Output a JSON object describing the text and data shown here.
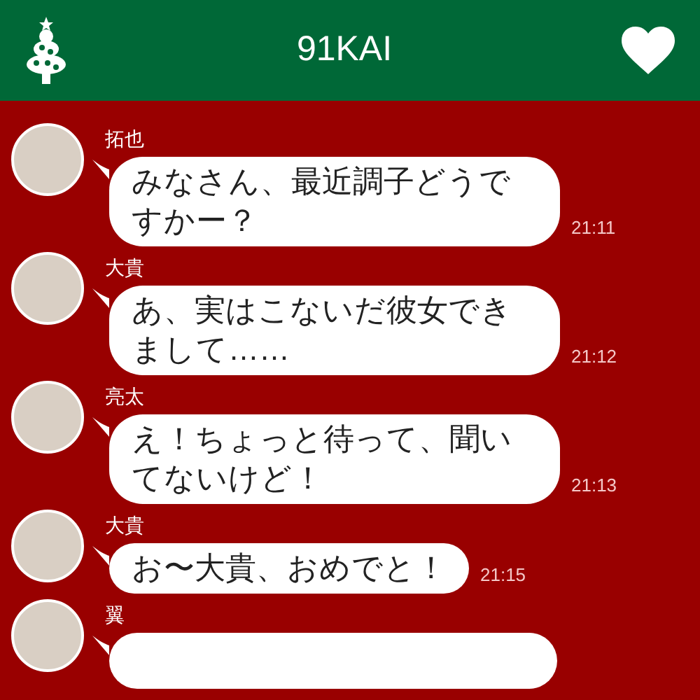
{
  "header": {
    "title": "91KAI"
  },
  "messages": [
    {
      "sender": "拓也",
      "text": "みなさん、最近調子どうですかー？",
      "time": "21:11"
    },
    {
      "sender": "大貴",
      "text": "あ、実はこないだ彼女できまして……",
      "time": "21:12"
    },
    {
      "sender": "亮太",
      "text": "え！ちょっと待って、聞いてないけど！",
      "time": "21:13"
    },
    {
      "sender": "大貴",
      "text": "お〜大貴、おめでと！",
      "time": "21:15"
    },
    {
      "sender": "翼"
    }
  ]
}
